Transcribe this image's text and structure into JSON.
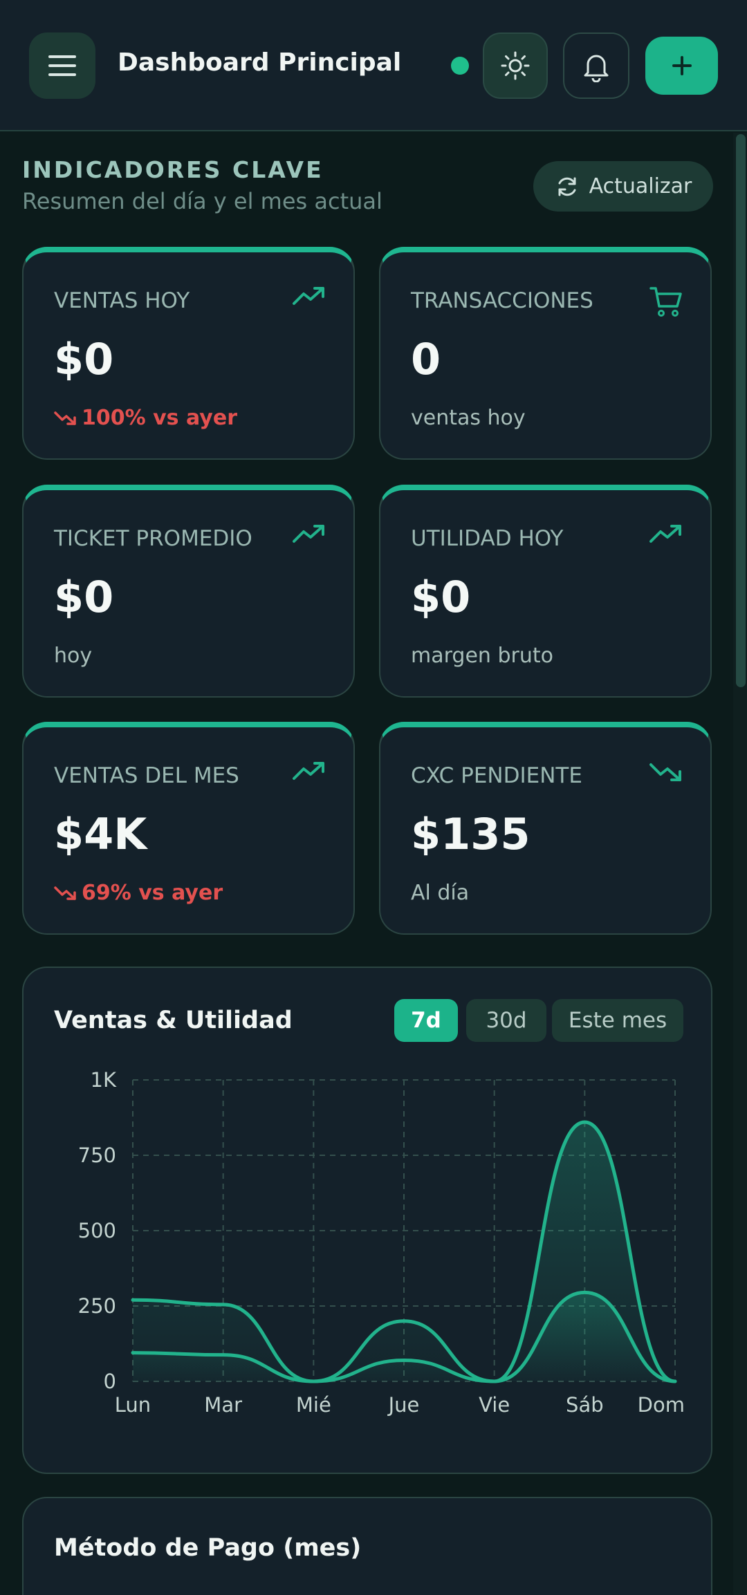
{
  "header": {
    "title": "Dashboard Principal",
    "menu_icon": "hamburger-icon",
    "theme_icon": "sun-icon",
    "bell_icon": "bell-icon",
    "add_icon": "plus-icon",
    "status_color": "#1fbf8c"
  },
  "section": {
    "title": "INDICADORES CLAVE",
    "subtitle": "Resumen del día y el mes actual",
    "refresh_label": "Actualizar"
  },
  "kpis": [
    {
      "label": "VENTAS HOY",
      "value": "$0",
      "sub": "100% vs ayer",
      "trend": "down",
      "icon": "trending-up-icon"
    },
    {
      "label": "TRANSACCIONES",
      "value": "0",
      "sub": "ventas hoy",
      "icon": "cart-icon"
    },
    {
      "label": "TICKET PROMEDIO",
      "value": "$0",
      "sub": "hoy",
      "icon": "trending-up-icon"
    },
    {
      "label": "UTILIDAD HOY",
      "value": "$0",
      "sub": "margen bruto",
      "icon": "trending-up-icon"
    },
    {
      "label": "VENTAS DEL MES",
      "value": "$4K",
      "sub": "69% vs ayer",
      "trend": "down",
      "icon": "trending-up-icon"
    },
    {
      "label": "CXC PENDIENTE",
      "value": "$135",
      "sub": "Al día",
      "icon": "trending-down-icon"
    }
  ],
  "chart": {
    "title": "Ventas & Utilidad",
    "ranges": [
      "7d",
      "30d",
      "Este mes"
    ],
    "active_range": "7d"
  },
  "chart_data": {
    "type": "area",
    "categories": [
      "Lun",
      "Mar",
      "Mié",
      "Jue",
      "Vie",
      "Sáb",
      "Dom"
    ],
    "series": [
      {
        "values": [
          270,
          255,
          0,
          200,
          0,
          860,
          0
        ]
      },
      {
        "values": [
          95,
          88,
          0,
          70,
          0,
          295,
          0
        ]
      }
    ],
    "yticks": [
      "0",
      "250",
      "500",
      "750",
      "1K"
    ],
    "ylim": [
      0,
      1000
    ],
    "grid": true,
    "color": "#22b38c"
  },
  "payment": {
    "title": "Método de Pago (mes)"
  }
}
